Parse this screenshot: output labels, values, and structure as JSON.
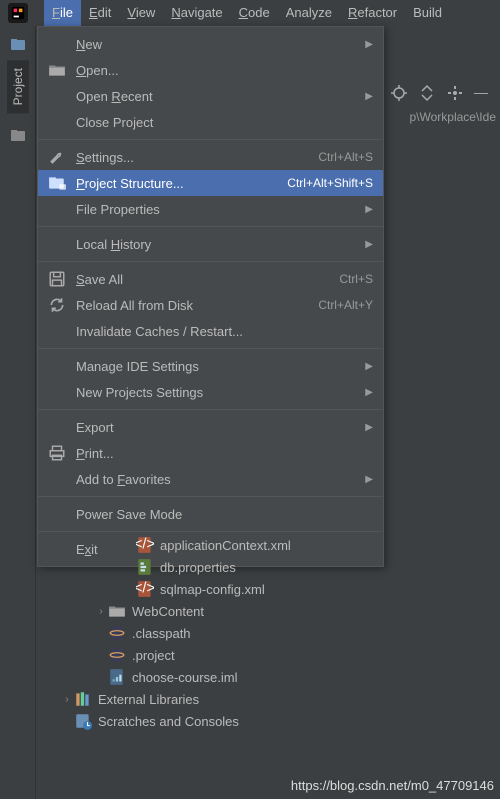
{
  "menubar": {
    "items": [
      "File",
      "Edit",
      "View",
      "Navigate",
      "Code",
      "Analyze",
      "Refactor",
      "Build"
    ],
    "underlines": [
      "F",
      "E",
      "V",
      "N",
      "C",
      "",
      "R",
      ""
    ]
  },
  "active_menu_index": 0,
  "dropdown": {
    "items": [
      {
        "type": "item",
        "icon": "",
        "label": "New",
        "u": "N",
        "shortcut": "",
        "arrow": true
      },
      {
        "type": "item",
        "icon": "folder",
        "label": "Open...",
        "u": "O",
        "shortcut": "",
        "arrow": false
      },
      {
        "type": "item",
        "icon": "",
        "label": "Open Recent",
        "u": "R",
        "shortcut": "",
        "arrow": true
      },
      {
        "type": "item",
        "icon": "",
        "label": "Close Project",
        "u": "",
        "shortcut": "",
        "arrow": false
      },
      {
        "type": "sep"
      },
      {
        "type": "item",
        "icon": "wrench",
        "label": "Settings...",
        "u": "S",
        "shortcut": "Ctrl+Alt+S",
        "arrow": false
      },
      {
        "type": "item",
        "icon": "proj",
        "label": "Project Structure...",
        "u": "P",
        "shortcut": "Ctrl+Alt+Shift+S",
        "arrow": false,
        "highlight": true
      },
      {
        "type": "item",
        "icon": "",
        "label": "File Properties",
        "u": "",
        "shortcut": "",
        "arrow": true
      },
      {
        "type": "sep"
      },
      {
        "type": "item",
        "icon": "",
        "label": "Local History",
        "u": "H",
        "shortcut": "",
        "arrow": true
      },
      {
        "type": "sep"
      },
      {
        "type": "item",
        "icon": "save",
        "label": "Save All",
        "u": "S",
        "shortcut": "Ctrl+S",
        "arrow": false
      },
      {
        "type": "item",
        "icon": "reload",
        "label": "Reload All from Disk",
        "u": "",
        "shortcut": "Ctrl+Alt+Y",
        "arrow": false
      },
      {
        "type": "item",
        "icon": "",
        "label": "Invalidate Caches / Restart...",
        "u": "",
        "shortcut": "",
        "arrow": false
      },
      {
        "type": "sep"
      },
      {
        "type": "item",
        "icon": "",
        "label": "Manage IDE Settings",
        "u": "",
        "shortcut": "",
        "arrow": true
      },
      {
        "type": "item",
        "icon": "",
        "label": "New Projects Settings",
        "u": "",
        "shortcut": "",
        "arrow": true
      },
      {
        "type": "sep"
      },
      {
        "type": "item",
        "icon": "",
        "label": "Export",
        "u": "",
        "shortcut": "",
        "arrow": true
      },
      {
        "type": "item",
        "icon": "print",
        "label": "Print...",
        "u": "P",
        "shortcut": "",
        "arrow": false
      },
      {
        "type": "item",
        "icon": "",
        "label": "Add to Favorites",
        "u": "F",
        "shortcut": "",
        "arrow": true
      },
      {
        "type": "sep"
      },
      {
        "type": "item",
        "icon": "",
        "label": "Power Save Mode",
        "u": "",
        "shortcut": "",
        "arrow": false
      },
      {
        "type": "sep"
      },
      {
        "type": "item",
        "icon": "",
        "label": "Exit",
        "u": "x",
        "shortcut": "",
        "arrow": false
      }
    ]
  },
  "tab_path": "p\\Workplace\\Ide",
  "sidebar": {
    "label": "Project"
  },
  "tree": {
    "rows": [
      {
        "indent": "ind1",
        "arrow": "",
        "icon": "xml",
        "label": "applicationContext.xml"
      },
      {
        "indent": "ind1",
        "arrow": "",
        "icon": "props",
        "label": "db.properties"
      },
      {
        "indent": "ind1",
        "arrow": "",
        "icon": "xml",
        "label": "sqlmap-config.xml"
      },
      {
        "indent": "ind2",
        "arrow": "›",
        "icon": "folder",
        "label": "WebContent"
      },
      {
        "indent": "ind2",
        "arrow": "",
        "icon": "eclipse",
        "label": ".classpath"
      },
      {
        "indent": "ind2",
        "arrow": "",
        "icon": "eclipse",
        "label": ".project"
      },
      {
        "indent": "ind2",
        "arrow": "",
        "icon": "iml",
        "label": "choose-course.iml"
      },
      {
        "indent": "ind3",
        "arrow": "›",
        "icon": "libs",
        "label": "External Libraries"
      },
      {
        "indent": "ind3",
        "arrow": "",
        "icon": "scratch",
        "label": "Scratches and Consoles"
      }
    ]
  },
  "watermark": "https://blog.csdn.net/m0_47709146"
}
